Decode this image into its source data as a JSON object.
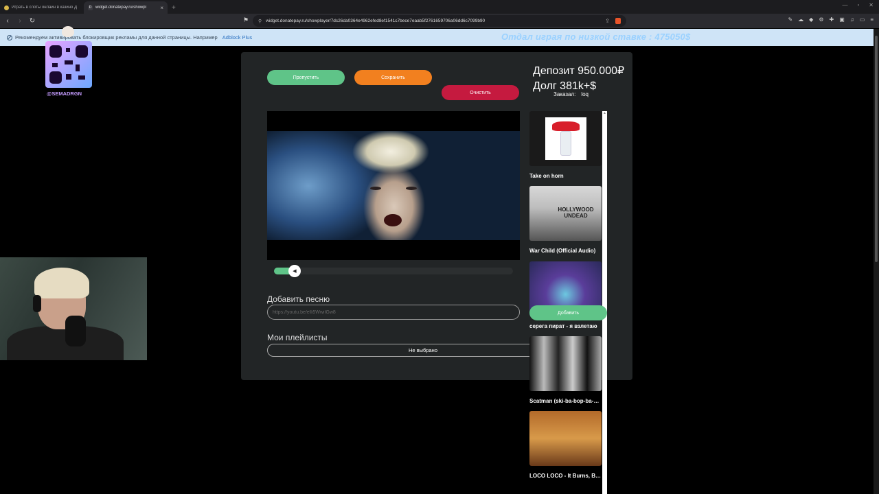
{
  "browser": {
    "tabs": [
      {
        "title": "Играть в слоты онлайн в казино Д",
        "active": false
      },
      {
        "title": "widget.donatepay.ru/showpl",
        "active": true,
        "favicon": "D"
      }
    ],
    "url": "widget.donatepay.ru/showplayer/7dc26da0364e4962efed8ef1541c7bece7eaab5f2761659706a06dd6c7099b90"
  },
  "notice": {
    "text": "Рекомендуем активировать блокировщик рекламы для данной страницы. Например",
    "link": "Adblock Plus"
  },
  "ticker": "Отдал играя по низкой ставке : 475050$",
  "overlay": {
    "handle": "@SEMADRGN"
  },
  "player": {
    "skip_label": "Пропустить",
    "save_label": "Сохранить",
    "clear_label": "Очистить",
    "deposit": "Депозит 950.000₽",
    "debt": "Долг  381k+$",
    "ordered_label": "Заказал:",
    "ordered_by": "loq",
    "progress_fraction": 0.06,
    "add_song_label": "Добавить песню",
    "add_song_placeholder": "https://youtu.be/elli5WwiIGw8",
    "add_button": "Добавить",
    "playlists_label": "Мои плейлисты",
    "playlist_selected": "Не выбрано"
  },
  "queue": [
    {
      "title": "Take on horn"
    },
    {
      "title": "War Child (Official Audio)",
      "thumb_text": "HOLLYWOOD UNDEAD"
    },
    {
      "title": "серега пират - я взлетаю"
    },
    {
      "title": "Scatman (ski-ba-bop-ba-dop-bop)"
    },
    {
      "title": "LOCO LOCO - It Burns, Burns, Burns"
    }
  ],
  "colors": {
    "skip": "#5fc488",
    "save": "#f2801f",
    "clear": "#c51a3f",
    "widget_bg": "#222526",
    "notice_bg": "#cfe4f7",
    "ticker": "#9ad1ff"
  }
}
